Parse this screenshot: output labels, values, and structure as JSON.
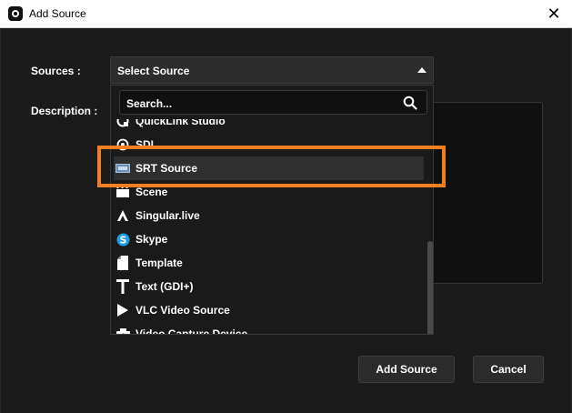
{
  "window": {
    "title": "Add Source",
    "close_glyph": "✕"
  },
  "form": {
    "sources_label": "Sources :",
    "description_label": "Description :"
  },
  "select": {
    "value": "Select Source",
    "arrow_icon": "chevron-up-icon"
  },
  "search": {
    "placeholder": "Search...",
    "icon": "search-icon"
  },
  "list": {
    "items": [
      {
        "label": "QuickLink Studio",
        "icon": "quicklink-icon"
      },
      {
        "label": "SDI",
        "icon": "sdi-icon"
      },
      {
        "label": "SRT Source",
        "icon": "srt-icon",
        "selected": true
      },
      {
        "label": "Scene",
        "icon": "scene-icon"
      },
      {
        "label": "Singular.live",
        "icon": "singular-icon"
      },
      {
        "label": "Skype",
        "icon": "skype-icon"
      },
      {
        "label": "Template",
        "icon": "template-icon"
      },
      {
        "label": "Text (GDI+)",
        "icon": "text-icon"
      },
      {
        "label": "VLC Video Source",
        "icon": "play-icon"
      },
      {
        "label": "Video Capture Device",
        "icon": "camera-icon"
      }
    ]
  },
  "buttons": {
    "add": "Add Source",
    "cancel": "Cancel"
  },
  "colors": {
    "highlight": "#f47f20",
    "background": "#1b1b1b",
    "titlebar": "#ffffff"
  }
}
